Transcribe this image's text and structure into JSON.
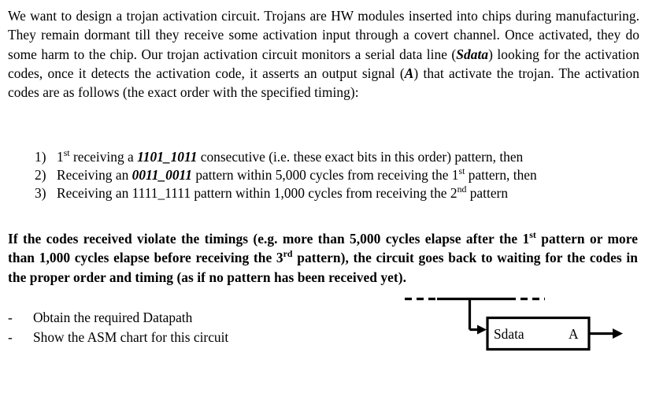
{
  "document": {
    "intro": {
      "segments": [
        {
          "t": "We want to design a trojan activation circuit. Trojans are HW modules inserted into chips during manufacturing. They remain dormant till they receive some activation input through a covert channel.  Once activated, they do some harm to the chip. Our trojan activation circuit monitors a serial data line (",
          "style": "plain"
        },
        {
          "t": "Sdata",
          "style": "bold-italic"
        },
        {
          "t": ") looking for the activation codes, once it detects the activation code, it asserts an output signal (",
          "style": "plain"
        },
        {
          "t": "A",
          "style": "bold-italic"
        },
        {
          "t": ") that activate the trojan. The activation codes are as follows (the exact order with the specified timing):",
          "style": "plain"
        }
      ],
      "full_text": "We want to design a trojan activation circuit. Trojans are HW modules inserted into chips during manufacturing. They remain dormant till they receive some activation input through a covert channel.  Once activated, they do some harm to the chip. Our trojan activation circuit monitors a serial data line (Sdata) looking for the activation codes, once it detects the activation code, it asserts an output signal (A) that activate the trojan. The activation codes are as follows (the exact order with the specified timing):"
    },
    "codes_list": [
      {
        "marker": "1)",
        "prefix": "1",
        "ordinal_sup": "st",
        "mid": " receiving a ",
        "pattern": "1101_1011",
        "pattern_style": "bold-italic",
        "suffix": " consecutive (i.e. these exact bits in this order) pattern, then",
        "suffix2": ""
      },
      {
        "marker": "2)",
        "prefix": "Receiving an  ",
        "ordinal_sup": "",
        "mid": "",
        "pattern": "0011_0011",
        "pattern_style": "bold-italic",
        "suffix": " pattern within 5,000 cycles from receiving the 1",
        "suffix_sup": "st",
        "suffix2": " pattern, then"
      },
      {
        "marker": "3)",
        "prefix": "Receiving an ",
        "ordinal_sup": "",
        "mid": "",
        "pattern": "1111_1111",
        "pattern_style": "plain",
        "suffix": " pattern within 1,000 cycles from receiving the 2",
        "suffix_sup": "nd",
        "suffix2": " pattern"
      }
    ],
    "timing_violation": {
      "part1": "If the codes received violate the timings (e.g. more than 5,000 cycles elapse after the 1",
      "sup1": "st",
      "part2": " pattern or more than 1,000 cycles elapse before receiving the 3",
      "sup2": "rd",
      "part3": " pattern), the circuit goes back to waiting for the codes in the proper order and timing (as if no pattern has been received yet).",
      "full_text": "If the codes received violate the timings (e.g. more than 5,000 cycles elapse after the 1st pattern or more than 1,000 cycles elapse before receiving the 3rd pattern), the circuit goes back to waiting for the codes in the proper order and timing (as if no pattern has been received yet)."
    },
    "tasks": [
      {
        "marker": "-",
        "label": "Obtain the required Datapath"
      },
      {
        "marker": "-",
        "label": "Show the ASM chart for this circuit"
      }
    ],
    "diagram": {
      "input_label": "Sdata",
      "output_label": "A",
      "line_color": "#000000"
    }
  }
}
